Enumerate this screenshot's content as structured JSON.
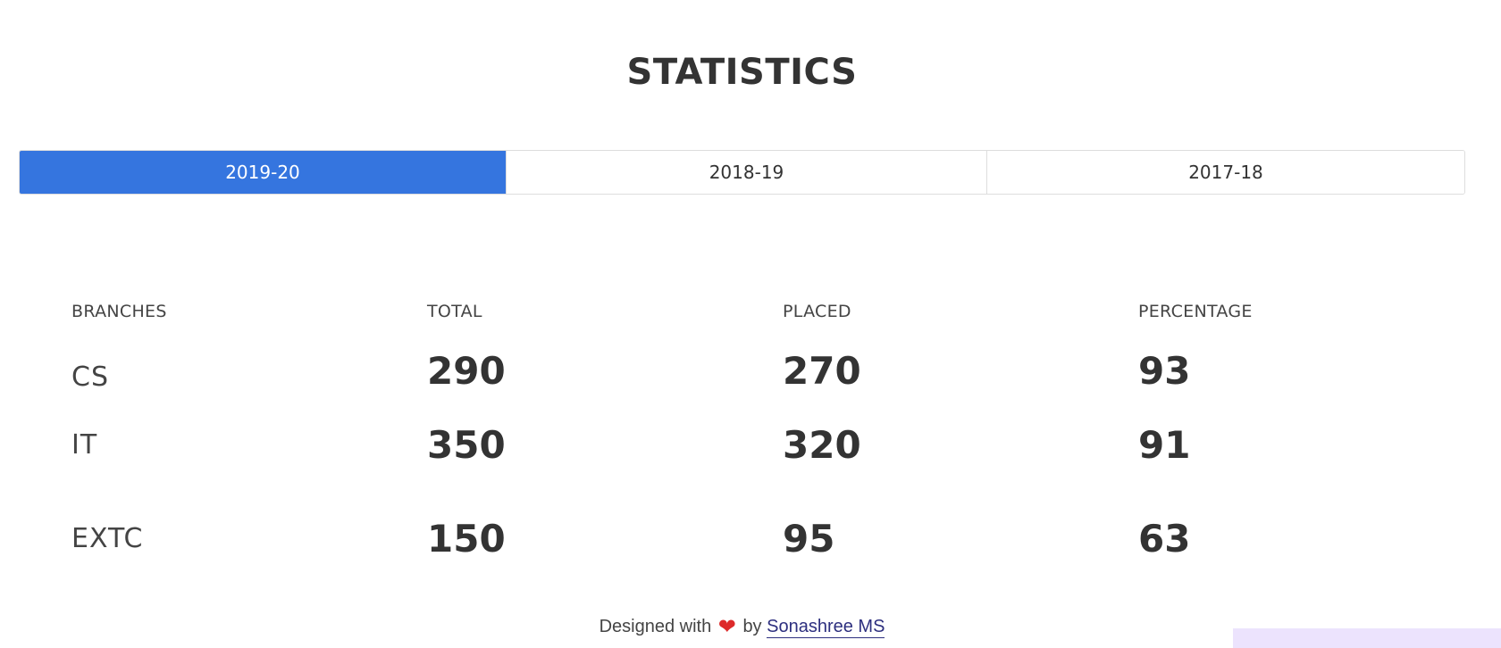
{
  "page": {
    "title": "STATISTICS"
  },
  "tabs": [
    {
      "label": "2019-20",
      "active": true
    },
    {
      "label": "2018-19",
      "active": false
    },
    {
      "label": "2017-18",
      "active": false
    }
  ],
  "table": {
    "headers": [
      "BRANCHES",
      "TOTAL",
      "PLACED",
      "PERCENTAGE"
    ],
    "rows": [
      {
        "branch": "CS",
        "total": "290",
        "placed": "270",
        "percentage": "93"
      },
      {
        "branch": "IT",
        "total": "350",
        "placed": "320",
        "percentage": "91"
      },
      {
        "branch": "EXTC",
        "total": "150",
        "placed": "95",
        "percentage": "63"
      }
    ]
  },
  "footer": {
    "prefix": "Designed with",
    "heart_icon": "heart-icon",
    "by": "by",
    "author": "Sonashree MS"
  },
  "colors": {
    "active_tab": "#3575df",
    "heart": "#dd2a2a",
    "link": "#2d2f7f",
    "corner_box": "#ece3fd"
  }
}
